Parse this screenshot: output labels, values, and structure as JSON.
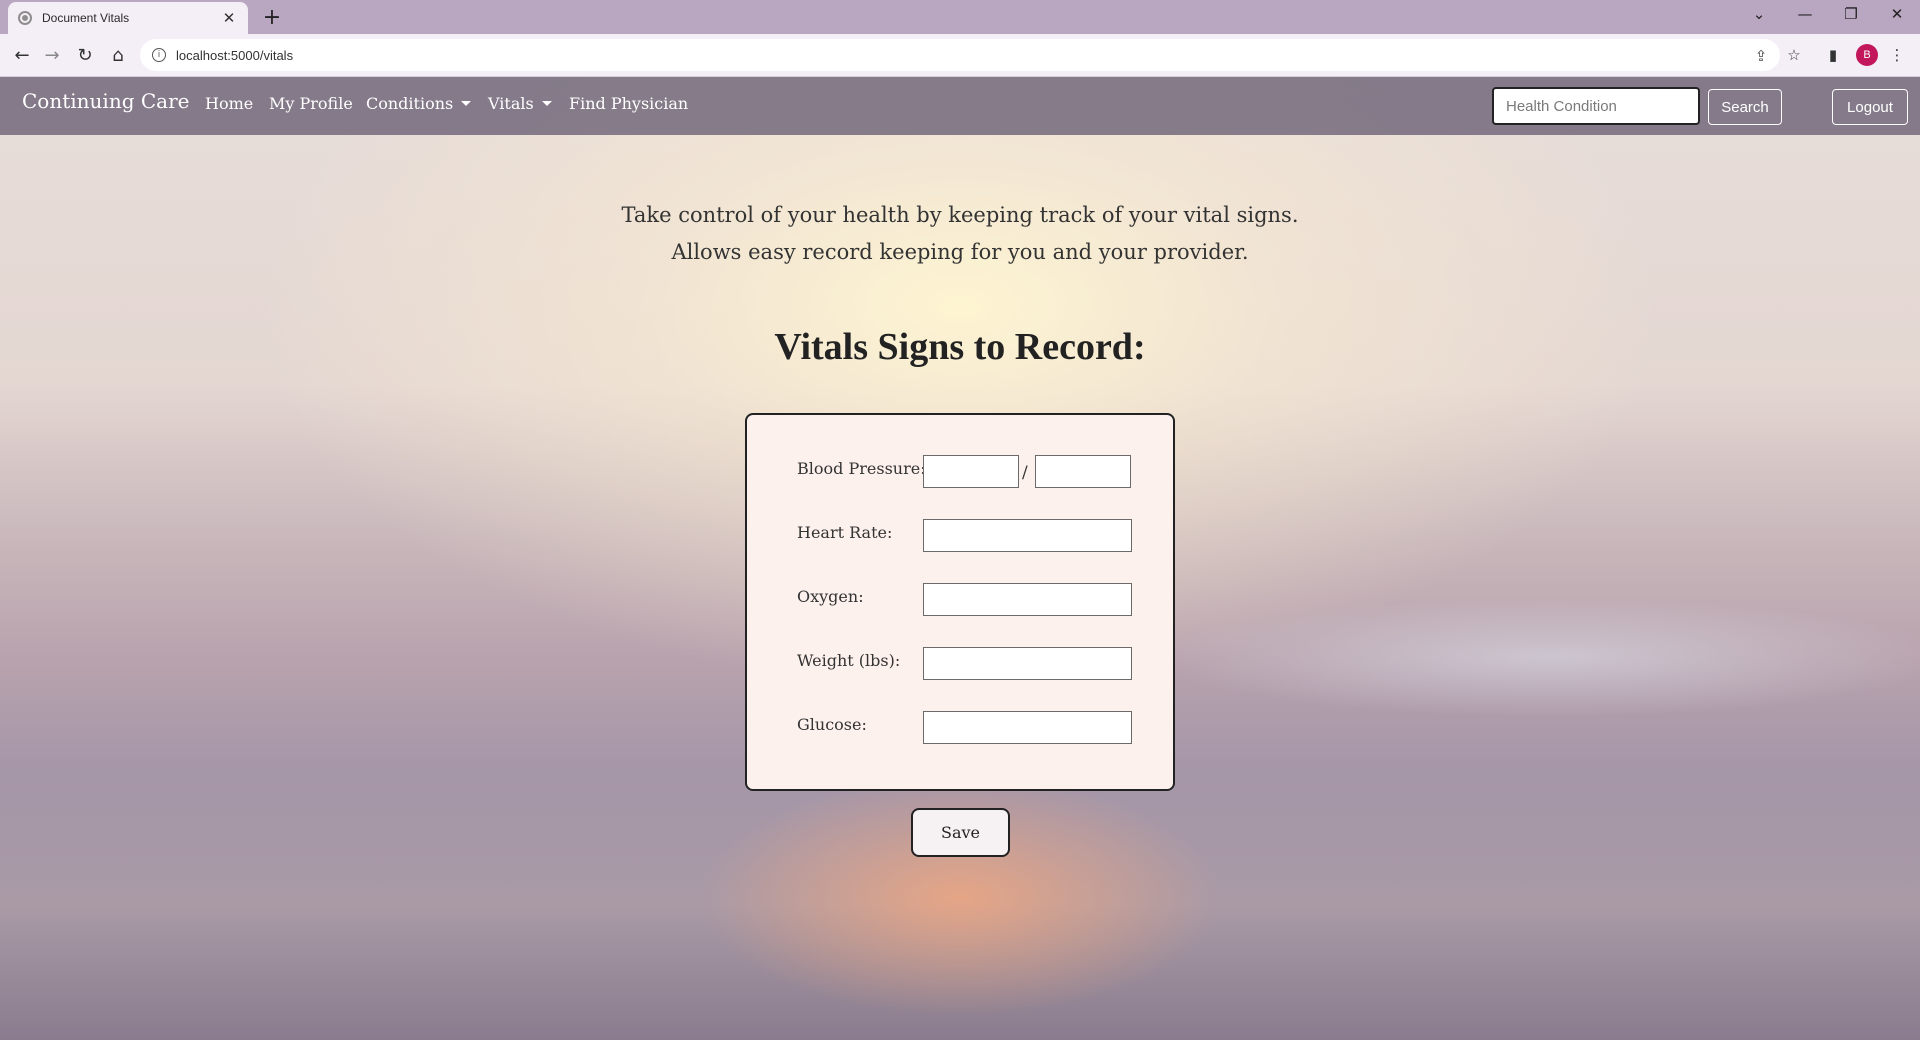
{
  "browser": {
    "tab_title": "Document Vitals",
    "url": "localhost:5000/vitals",
    "profile_initial": "B"
  },
  "site": {
    "brand": "Continuing Care",
    "nav": {
      "home": "Home",
      "profile": "My Profile",
      "conditions": "Conditions",
      "vitals": "Vitals",
      "find_physician": "Find Physician"
    },
    "search": {
      "placeholder": "Health Condition",
      "button": "Search"
    },
    "logout": "Logout"
  },
  "content": {
    "intro_line1": "Take control of your health by keeping track of your vital signs.",
    "intro_line2": "Allows easy record keeping for you and your provider.",
    "heading": "Vitals Signs to Record:",
    "form": {
      "blood_pressure_label": "Blood Pressure:",
      "bp_separator": "/",
      "heart_rate_label": "Heart Rate:",
      "oxygen_label": "Oxygen:",
      "weight_label": "Weight (lbs):",
      "glucose_label": "Glucose:"
    },
    "save": "Save"
  },
  "colors": {
    "navbar": "#6e6478",
    "form_background": "#fdf1ee",
    "avatar": "#c2185b"
  }
}
